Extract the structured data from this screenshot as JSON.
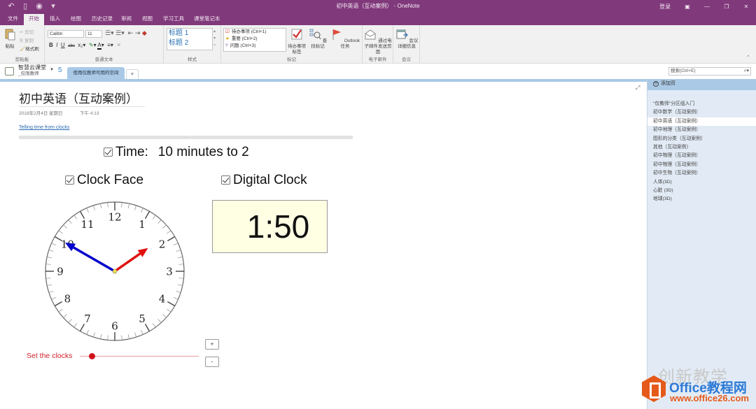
{
  "window": {
    "title": "初中英语（互动案例） - OneNote",
    "quick_access": [
      "undo-icon",
      "print-preview-icon",
      "back-icon",
      "customize-icon"
    ],
    "login_label": "登录",
    "controls": [
      "ribbon-display-icon",
      "minimize-icon",
      "restore-icon",
      "close-icon"
    ]
  },
  "ribbon_tabs": [
    {
      "label": "文件",
      "active": false
    },
    {
      "label": "开始",
      "active": true
    },
    {
      "label": "插入",
      "active": false
    },
    {
      "label": "绘图",
      "active": false
    },
    {
      "label": "历史记录",
      "active": false
    },
    {
      "label": "审阅",
      "active": false
    },
    {
      "label": "视图",
      "active": false
    },
    {
      "label": "学习工具",
      "active": false
    },
    {
      "label": "课堂笔记本",
      "active": false
    }
  ],
  "ribbon": {
    "clipboard": {
      "label": "剪贴板",
      "paste": "粘贴",
      "cut": "剪切",
      "copy": "复制",
      "format_painter": "格式刷"
    },
    "basic_text": {
      "label": "普通文本",
      "font": "Calibri",
      "size": "11"
    },
    "styles": {
      "label": "样式",
      "items": [
        "标题 1",
        "标题 2"
      ]
    },
    "tags": {
      "label": "标记",
      "items": [
        "待办事项 (Ctrl+1)",
        "重要 (Ctrl+2)",
        "问题 (Ctrl+3)"
      ],
      "todo_tag": "待办事项标签",
      "find_tags": "查找标记",
      "outlook_tasks": "Outlook 任务"
    },
    "email": {
      "label": "电子邮件",
      "button": "通过电子邮件发送页面"
    },
    "meetings": {
      "label": "会议",
      "button": "会议详细信息"
    }
  },
  "notebook": {
    "name": "智慧云课堂",
    "sub": "_仅限教师",
    "section_count": "5",
    "section_tab": "使用仅教师可用的空间",
    "add_tab": "+"
  },
  "search": {
    "placeholder": "搜索(Ctrl+E)"
  },
  "pages_panel": {
    "add_page": "添加页",
    "pages": [
      {
        "label": "\"仅教师\"分区组入门",
        "selected": false
      },
      {
        "label": "初中数学（互动案例）",
        "selected": false
      },
      {
        "label": "初中英语（互动案例）",
        "selected": true
      },
      {
        "label": "初中地理（互动案例）",
        "selected": false
      },
      {
        "label": "图形的分类（互动案例）",
        "selected": false
      },
      {
        "label": "其他（互动案例）",
        "selected": false
      },
      {
        "label": "初中物理（互动案例）",
        "selected": false
      },
      {
        "label": "初中物理（互动案例）",
        "selected": false
      },
      {
        "label": "初中生物（互动案例）",
        "selected": false
      },
      {
        "label": "人体(3D)",
        "selected": false
      },
      {
        "label": "心脏 (3D)",
        "selected": false
      },
      {
        "label": "地球(3D)",
        "selected": false
      }
    ]
  },
  "page": {
    "title": "初中英语（互动案例）",
    "date": "2018年2月4日 星期日",
    "time": "下午 4:13",
    "link": "Telling time from clocks"
  },
  "widget": {
    "time_label": "Time:",
    "time_value": "10 minutes to 2",
    "time_checked": true,
    "clock_face_label": "Clock Face",
    "clock_face_checked": true,
    "digital_clock_label": "Digital Clock",
    "digital_clock_checked": true,
    "digital_display": "1:50",
    "hour": 1,
    "minute": 50,
    "clock_numbers": [
      "12",
      "1",
      "2",
      "3",
      "4",
      "5",
      "6",
      "7",
      "8",
      "9",
      "10",
      "11"
    ],
    "slider_label": "Set the clocks",
    "slider_fraction": 0.1,
    "plus_label": "+",
    "minus_label": "-",
    "colors": {
      "minute_hand": "#0000cc",
      "hour_hand": "#e01010",
      "accent": "#d11f2c"
    }
  },
  "watermark": {
    "text": "创新教学",
    "brand": "Office教程网",
    "url": "www.office26.com"
  }
}
